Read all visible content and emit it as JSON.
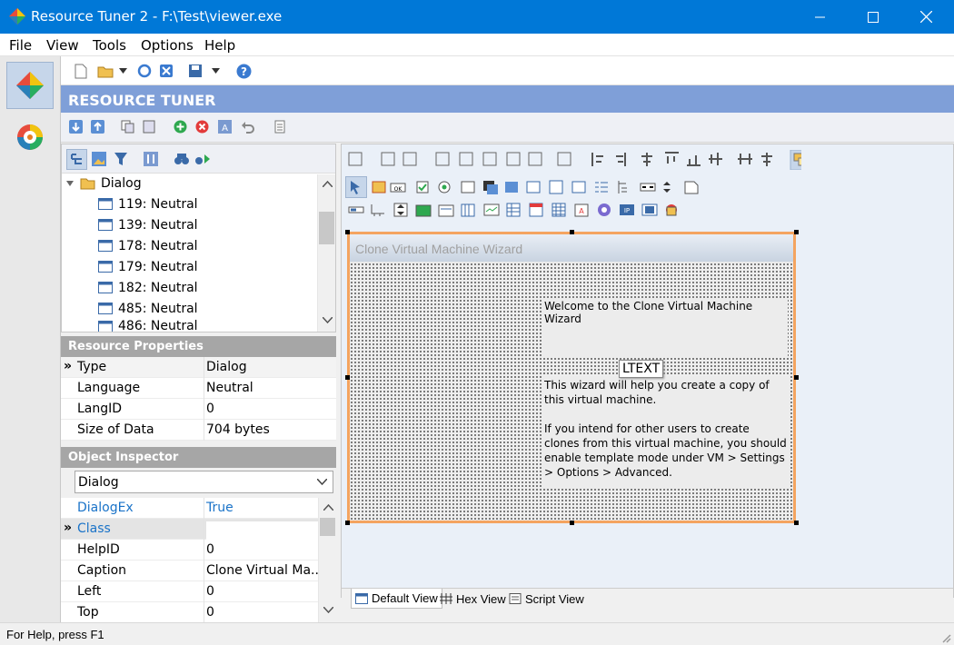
{
  "window": {
    "title": "Resource Tuner 2 - F:\\Test\\viewer.exe"
  },
  "menu": [
    "File",
    "View",
    "Tools",
    "Options",
    "Help"
  ],
  "header": {
    "title": "RESOURCE TUNER"
  },
  "tree": {
    "folder": "Dialog",
    "items": [
      "119: Neutral",
      "139: Neutral",
      "178: Neutral",
      "179: Neutral",
      "182: Neutral",
      "485: Neutral",
      "486: Neutral"
    ]
  },
  "resource_properties": {
    "title": "Resource Properties",
    "rows": [
      {
        "key": "Type",
        "value": "Dialog"
      },
      {
        "key": "Language",
        "value": "Neutral"
      },
      {
        "key": "LangID",
        "value": "0"
      },
      {
        "key": "Size of Data",
        "value": "704 bytes"
      }
    ]
  },
  "object_inspector": {
    "title": "Object Inspector",
    "selected": "Dialog",
    "rows": [
      {
        "key": "DialogEx",
        "value": "True"
      },
      {
        "key": "Class",
        "value": ""
      },
      {
        "key": "HelpID",
        "value": "0"
      },
      {
        "key": "Caption",
        "value": "Clone Virtual Ma..."
      },
      {
        "key": "Left",
        "value": "0"
      },
      {
        "key": "Top",
        "value": "0"
      }
    ]
  },
  "dialog_preview": {
    "caption": "Clone Virtual Machine Wizard",
    "welcome": "Welcome to the Clone Virtual Machine Wizard",
    "tooltip": "LTEXT",
    "para1": "This wizard will help you create a copy of this virtual machine.",
    "para2": "If you intend for other users to create clones from this virtual machine, you should enable template mode under VM > Settings > Options > Advanced."
  },
  "view_tabs": [
    "Default View",
    "Hex View",
    "Script View"
  ],
  "status": {
    "text": "For Help, press F1"
  },
  "colors": {
    "titlebar": "#0078d7",
    "header": "#7f9fd8",
    "selection": "#f4a460",
    "link": "#1a73c8"
  }
}
